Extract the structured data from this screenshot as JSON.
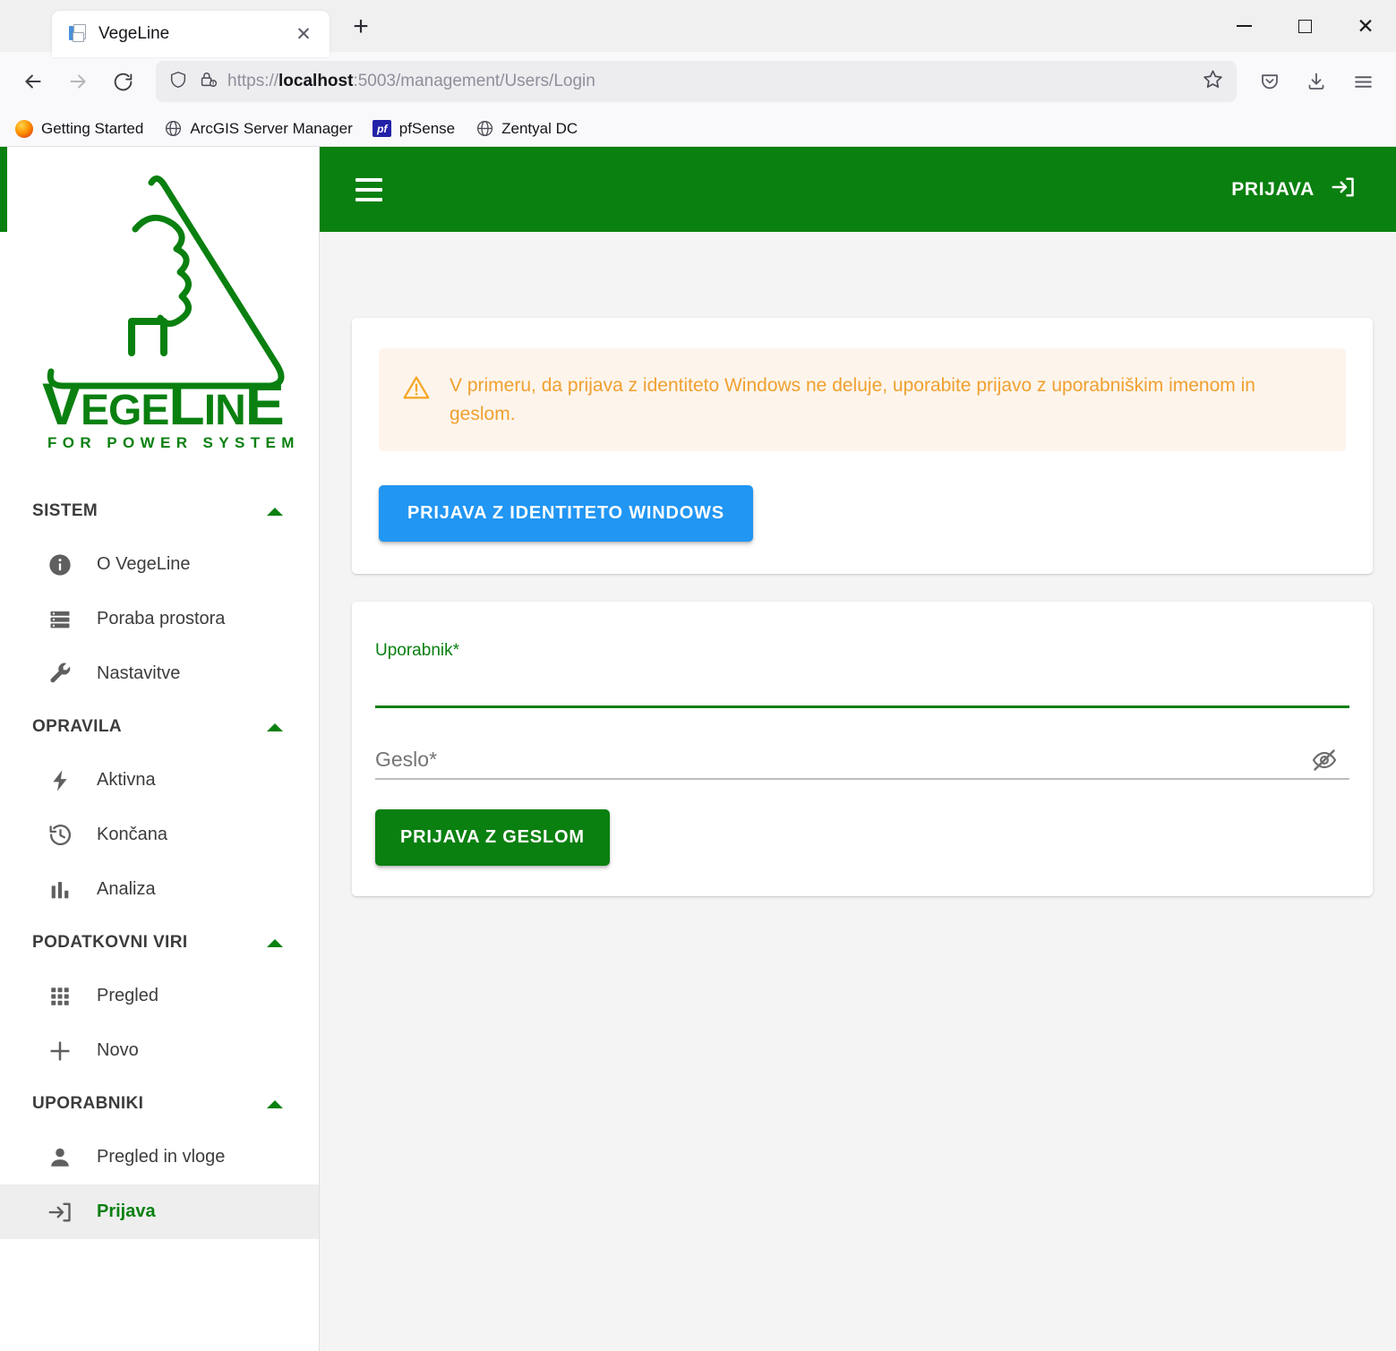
{
  "browser": {
    "tab": {
      "title": "VegeLine",
      "favicon": "document-icon",
      "close": "✕"
    },
    "newtab_label": "+",
    "window_controls": {
      "minimize": "minimize-icon",
      "maximize": "maximize-icon",
      "close": "✕"
    },
    "nav": {
      "back": "back-arrow-icon",
      "forward": "forward-arrow-icon",
      "reload": "reload-icon"
    },
    "url": {
      "scheme": "https://",
      "host": "localhost",
      "rest": ":5003/management/Users/Login",
      "full": "https://localhost:5003/management/Users/Login",
      "shield_icon": "tracking-shield-icon",
      "lock_icon": "insecure-lock-icon",
      "bookmark_icon": "star-icon"
    },
    "toolbar_right": [
      "pocket-icon",
      "downloads-icon",
      "app-menu-icon"
    ],
    "bookmarks": [
      {
        "label": "Getting Started",
        "icon": "firefox-icon"
      },
      {
        "label": "ArcGIS Server Manager",
        "icon": "globe-icon"
      },
      {
        "label": "pfSense",
        "icon": "pfsense-icon"
      },
      {
        "label": "Zentyal DC",
        "icon": "globe-icon"
      }
    ]
  },
  "app": {
    "colors": {
      "green": "#0a8010",
      "blue": "#2196f3",
      "warning": "#f0a030",
      "warning_bg": "#fdf5ec"
    },
    "logo": {
      "wordmark": "VegeLinE",
      "tagline": "FOR POWER SYSTEMS"
    },
    "appbar": {
      "menu_icon": "hamburger-menu-icon",
      "login_label": "PRIJAVA",
      "login_icon": "login-arrow-icon"
    },
    "sidebar": {
      "sections": [
        {
          "title": "SISTEM",
          "items": [
            {
              "label": "O VegeLine",
              "icon": "info-icon",
              "active": false
            },
            {
              "label": "Poraba prostora",
              "icon": "storage-icon",
              "active": false
            },
            {
              "label": "Nastavitve",
              "icon": "wrench-icon",
              "active": false
            }
          ]
        },
        {
          "title": "OPRAVILA",
          "items": [
            {
              "label": "Aktivna",
              "icon": "bolt-icon",
              "active": false
            },
            {
              "label": "Končana",
              "icon": "history-icon",
              "active": false
            },
            {
              "label": "Analiza",
              "icon": "bar-chart-icon",
              "active": false
            }
          ]
        },
        {
          "title": "PODATKOVNI VIRI",
          "items": [
            {
              "label": "Pregled",
              "icon": "grid-icon",
              "active": false
            },
            {
              "label": "Novo",
              "icon": "plus-icon",
              "active": false
            }
          ]
        },
        {
          "title": "UPORABNIKI",
          "items": [
            {
              "label": "Pregled in vloge",
              "icon": "person-icon",
              "active": false
            },
            {
              "label": "Prijava",
              "icon": "login-arrow-icon",
              "active": true
            }
          ]
        }
      ]
    },
    "login": {
      "alert": {
        "icon": "warning-triangle-icon",
        "text": "V primeru, da prijava z identiteto Windows ne deluje, uporabite prijavo z uporabniškim imenom in geslom."
      },
      "windows_button": "PRIJAVA Z IDENTITETO WINDOWS",
      "username_field": {
        "label": "Uporabnik*",
        "value": "",
        "placeholder": ""
      },
      "password_field": {
        "label": "Geslo*",
        "value": "",
        "placeholder": "Geslo*",
        "toggle_icon": "eye-off-icon"
      },
      "password_button": "PRIJAVA Z GESLOM"
    }
  }
}
